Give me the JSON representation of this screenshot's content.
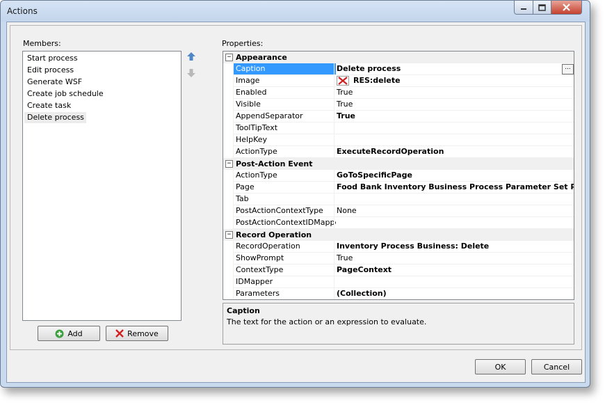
{
  "window": {
    "title": "Actions",
    "controls": {
      "minimize": "minimize-icon",
      "maximize": "maximize-icon",
      "close": "close-icon"
    }
  },
  "members": {
    "label": "Members:",
    "items": [
      "Start process",
      "Edit process",
      "Generate WSF",
      "Create job schedule",
      "Create task",
      "Delete process"
    ],
    "selected": "Delete process",
    "add_label": "Add",
    "remove_label": "Remove"
  },
  "properties": {
    "label": "Properties:",
    "categories": [
      {
        "name": "Appearance",
        "rows": [
          {
            "name": "Caption",
            "value": "Delete process"
          },
          {
            "name": "Image",
            "value": "RES:delete"
          },
          {
            "name": "Enabled",
            "value": "True"
          },
          {
            "name": "Visible",
            "value": "True"
          },
          {
            "name": "AppendSeparator",
            "value": "True"
          },
          {
            "name": "ToolTipText",
            "value": ""
          },
          {
            "name": "HelpKey",
            "value": ""
          },
          {
            "name": "ActionType",
            "value": "ExecuteRecordOperation"
          }
        ]
      },
      {
        "name": "Post-Action Event",
        "rows": [
          {
            "name": "ActionType",
            "value": "GoToSpecificPage"
          },
          {
            "name": "Page",
            "value": "Food Bank Inventory Business Process Parameter Set Page"
          },
          {
            "name": "Tab",
            "value": ""
          },
          {
            "name": "PostActionContextType",
            "value": "None"
          },
          {
            "name": "PostActionContextIDMapper",
            "value": ""
          }
        ]
      },
      {
        "name": "Record Operation",
        "rows": [
          {
            "name": "RecordOperation",
            "value": "Inventory Process Business: Delete"
          },
          {
            "name": "ShowPrompt",
            "value": "True"
          },
          {
            "name": "ContextType",
            "value": "PageContext"
          },
          {
            "name": "IDMapper",
            "value": ""
          },
          {
            "name": "Parameters",
            "value": "(Collection)"
          }
        ]
      }
    ],
    "ellipsis_label": "...",
    "description": {
      "title": "Caption",
      "text": "The text for the action or an expression to evaluate."
    }
  },
  "buttons": {
    "ok": "OK",
    "cancel": "Cancel"
  }
}
